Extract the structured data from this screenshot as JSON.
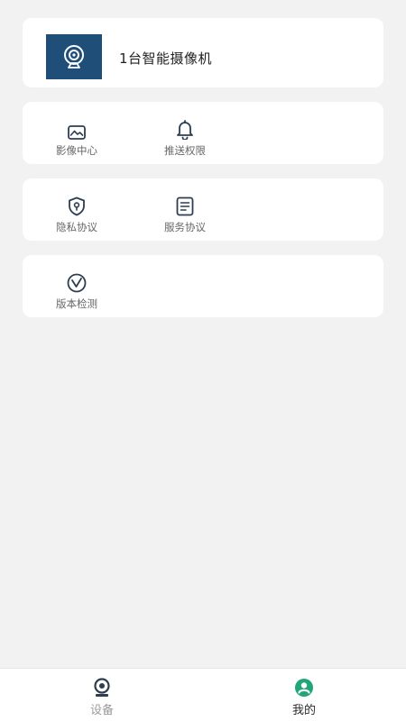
{
  "device": {
    "name": "1台智能摄像机",
    "thumb_icon": "camera-icon",
    "thumb_color": "#1f4e79"
  },
  "menu": {
    "media_center": "影像中心",
    "push_permission": "推送权限",
    "privacy_policy": "隐私协议",
    "service_agreement": "服务协议",
    "version_check": "版本检测"
  },
  "tabbar": {
    "devices": {
      "label": "设备",
      "icon": "webcam-icon"
    },
    "mine": {
      "label": "我的",
      "icon": "user-icon",
      "active": true
    }
  },
  "colors": {
    "accent": "#21a67a",
    "icon": "#2c3e50",
    "inactive_label": "#9a9a9a"
  }
}
